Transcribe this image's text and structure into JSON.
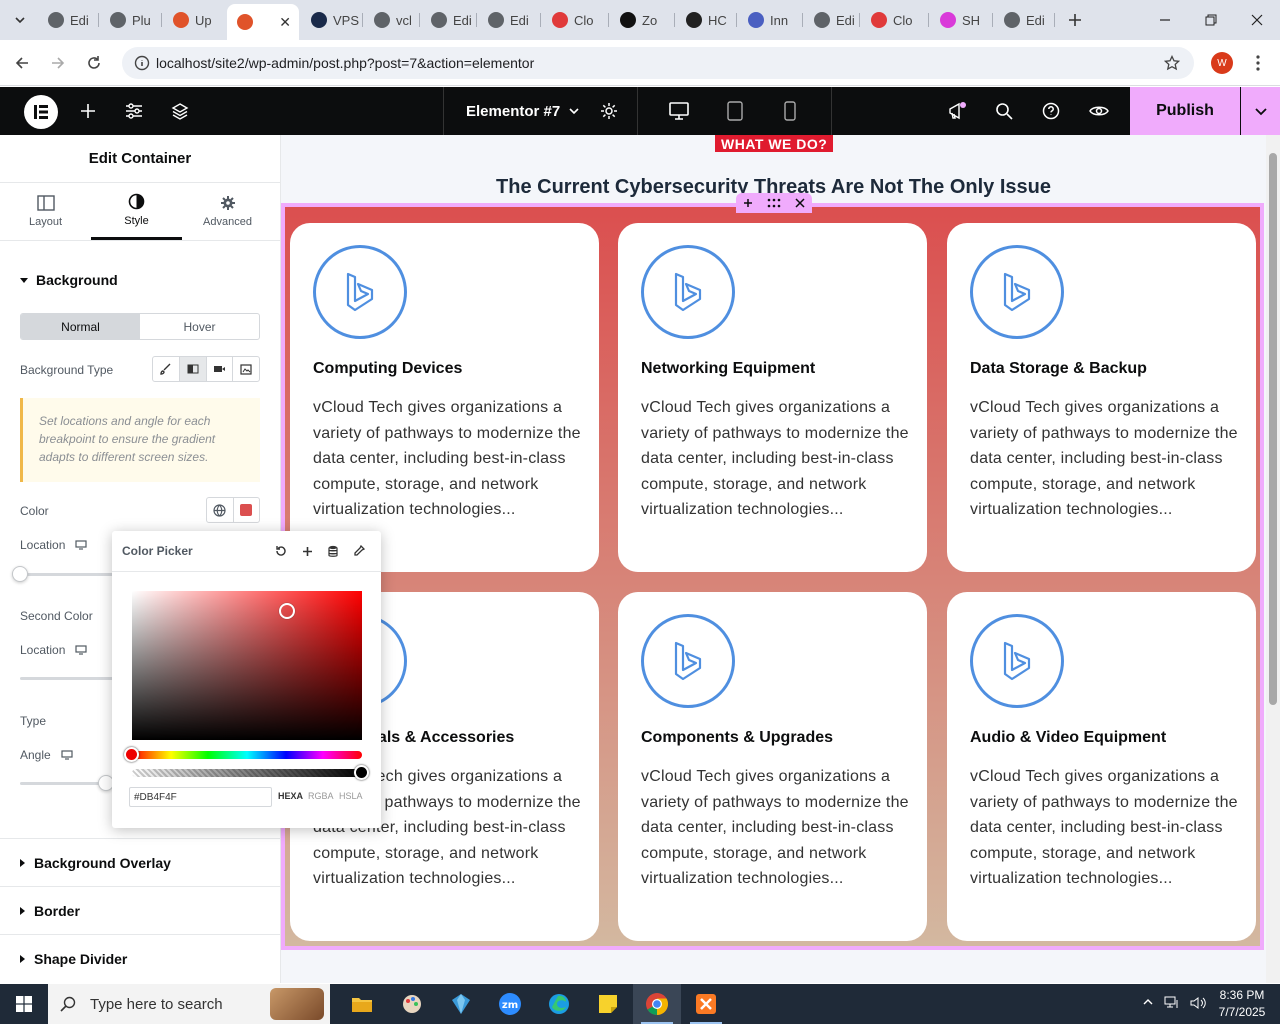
{
  "browser": {
    "tabs": [
      {
        "label": "Edi",
        "fav_color": "#5f6368"
      },
      {
        "label": "Plu",
        "fav_color": "#5f6368"
      },
      {
        "label": "Up",
        "fav_color": "#e0532a"
      },
      {
        "label": "",
        "fav_color": "#e0532a",
        "active": true
      },
      {
        "label": "VPS",
        "fav_color": "#1a2a4a"
      },
      {
        "label": "vcl",
        "fav_color": "#5f6368"
      },
      {
        "label": "Edi",
        "fav_color": "#5f6368"
      },
      {
        "label": "Edi",
        "fav_color": "#5f6368"
      },
      {
        "label": "Clo",
        "fav_color": "#e03a3a"
      },
      {
        "label": "Zo",
        "fav_color": "#111111"
      },
      {
        "label": "HC",
        "fav_color": "#222222"
      },
      {
        "label": "Inn",
        "fav_color": "#4a5fc1"
      },
      {
        "label": "Edi",
        "fav_color": "#5f6368"
      },
      {
        "label": "Clo",
        "fav_color": "#e03a3a"
      },
      {
        "label": "SH",
        "fav_color": "#d93ad9"
      },
      {
        "label": "Edi",
        "fav_color": "#5f6368"
      }
    ],
    "url": "localhost/site2/wp-admin/post.php?post=7&action=elementor",
    "profile_initial": "W"
  },
  "editor": {
    "doc_title": "Elementor #7",
    "publish_label": "Publish"
  },
  "panel": {
    "title": "Edit Container",
    "tabs": [
      "Layout",
      "Style",
      "Advanced"
    ],
    "active_tab": "Style",
    "background_section": "Background",
    "state_normal": "Normal",
    "state_hover": "Hover",
    "background_type_label": "Background Type",
    "note": "Set locations and angle for each breakpoint to ensure the gradient adapts to different screen sizes.",
    "color_label": "Color",
    "color_value": "#DB4F4F",
    "location_label": "Location",
    "second_color_label": "Second Color",
    "second_location_label": "Location",
    "type_label": "Type",
    "angle_label": "Angle",
    "collapsed_sections": [
      "Background Overlay",
      "Border",
      "Shape Divider"
    ]
  },
  "color_picker": {
    "title": "Color Picker",
    "hex_value": "#DB4F4F",
    "formats": [
      "HEXA",
      "RGBA",
      "HSLA"
    ],
    "active_format": "HEXA"
  },
  "canvas": {
    "tagline": "WHAT WE DO?",
    "heading": "The Current Cybersecurity Threats Are Not The Only Issue",
    "gradient_start": "#DB4F4F",
    "cards": [
      {
        "title": "Computing Devices",
        "desc": "vCloud Tech gives organizations a variety of pathways to modernize the data center, including best-in-class compute, storage, and network virtualization technologies..."
      },
      {
        "title": "Networking Equipment",
        "desc": "vCloud Tech gives organizations a variety of pathways to modernize the data center, including best-in-class compute, storage, and network virtualization technologies..."
      },
      {
        "title": "Data Storage & Backup",
        "desc": "vCloud Tech gives organizations a variety of pathways to modernize the data center, including best-in-class compute, storage, and network virtualization technologies..."
      },
      {
        "title": "Peripherals & Accessories",
        "desc": "vCloud Tech gives organizations a variety of pathways to modernize the data center, including best-in-class compute, storage, and network virtualization technologies..."
      },
      {
        "title": "Components & Upgrades",
        "desc": "vCloud Tech gives organizations a variety of pathways to modernize the data center, including best-in-class compute, storage, and network virtualization technologies..."
      },
      {
        "title": "Audio & Video Equipment",
        "desc": "vCloud Tech gives organizations a variety of pathways to modernize the data center, including best-in-class compute, storage, and network virtualization technologies..."
      }
    ]
  },
  "taskbar": {
    "search_placeholder": "Type here to search",
    "time": "8:36 PM",
    "date": "7/7/2025"
  }
}
